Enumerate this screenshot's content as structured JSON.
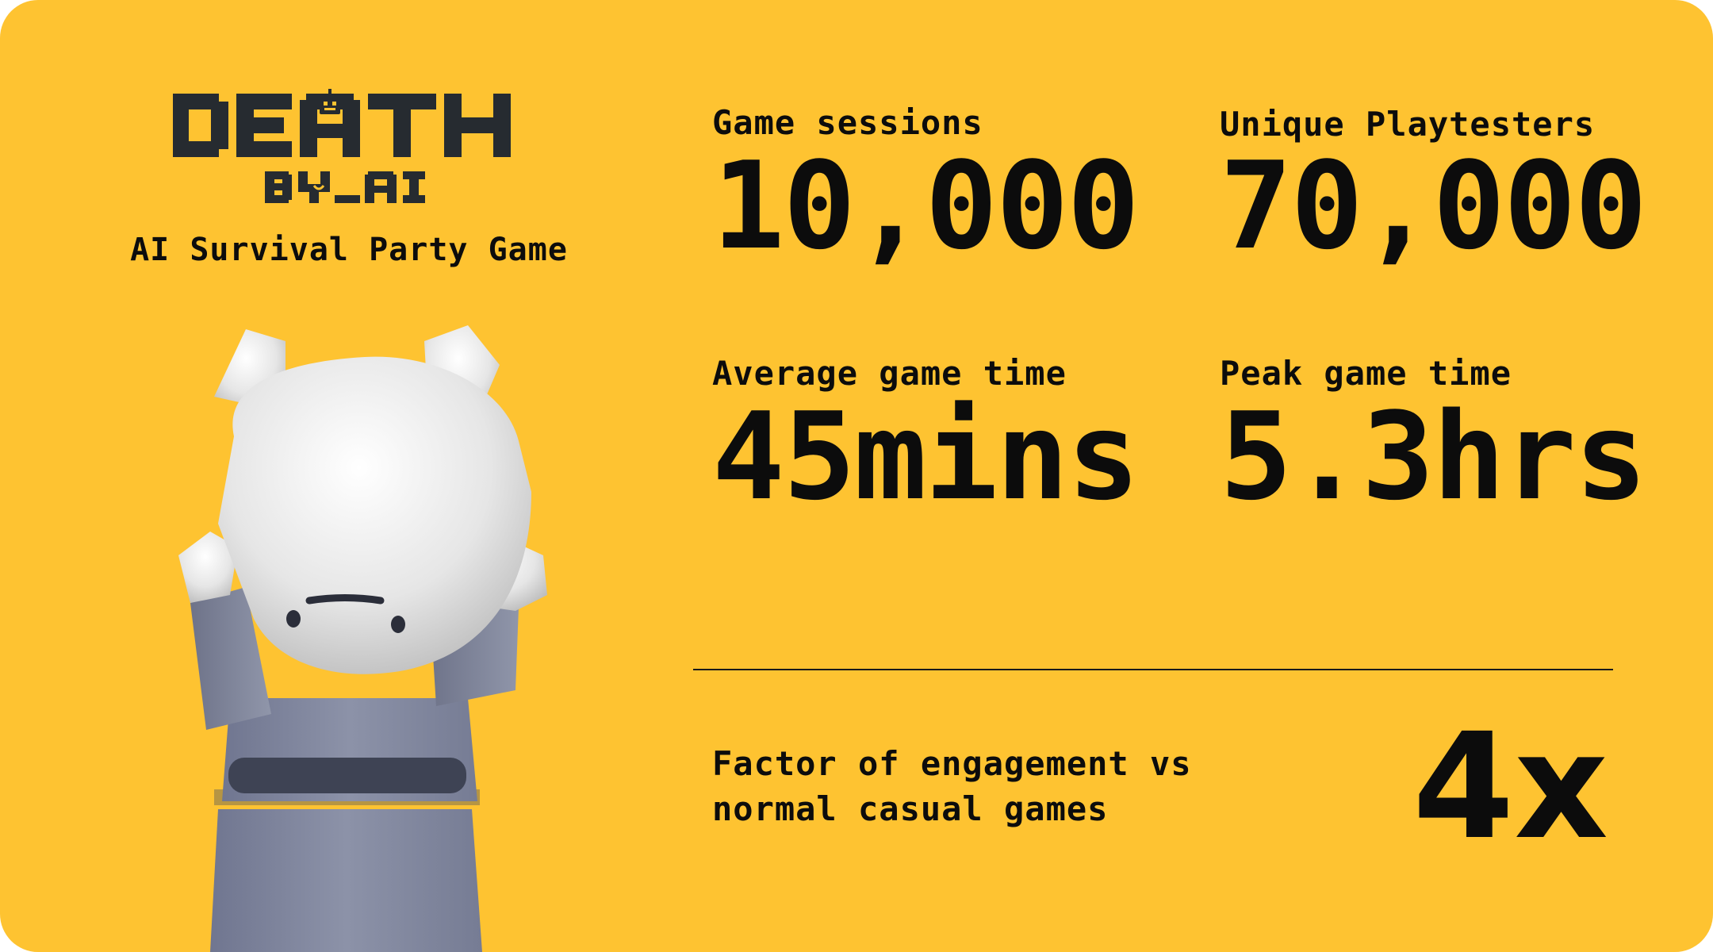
{
  "brand": {
    "logo_line1": "DEATH",
    "logo_line2": "BY_AI",
    "tagline": "AI Survival Party Game",
    "logo_color": "#262B30",
    "robot_icon_color": "#FEC331"
  },
  "theme": {
    "background": "#FEC331",
    "text": "#0C0C0C"
  },
  "stats": [
    {
      "label": "Game sessions",
      "value": "10,000"
    },
    {
      "label": "Unique Playtesters",
      "value": "70,000"
    },
    {
      "label": "Average game time",
      "value": "45mins"
    },
    {
      "label": "Peak game time",
      "value": "5.3hrs"
    }
  ],
  "engagement": {
    "label_line1": "Factor of engagement vs",
    "label_line2": "normal casual games",
    "value": "4x"
  },
  "mascot": {
    "icon": "robot-mascot-holding-head-icon"
  }
}
